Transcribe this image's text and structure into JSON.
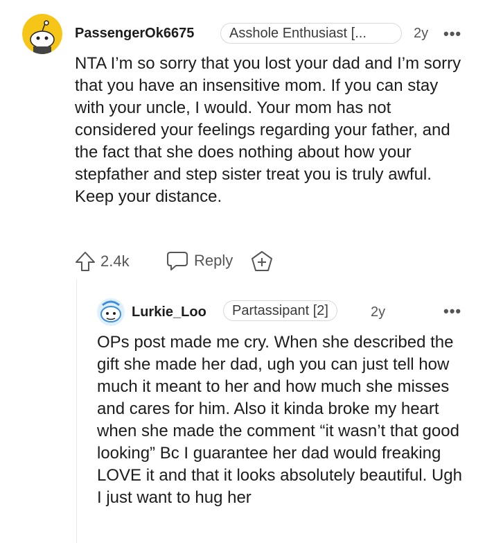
{
  "comment": {
    "username": "PassengerOk6675",
    "flair": "Asshole Enthusiast [...",
    "age": "2y",
    "more": "•••",
    "body": "NTA I’m so sorry that you lost your dad and I’m sorry that you have an insensitive mom. If you can stay with your uncle, I would. Your mom has not considered your feelings regarding your father, and the fact that she does nothing about how your stepfather and step sister treat you is truly awful. Keep your distance.",
    "upvotes": "2.4k",
    "reply_label": "Reply",
    "award_icon": "award-plus-icon",
    "avatar_color": "#f5c518"
  },
  "reply": {
    "username": "Lurkie_Loo",
    "flair": "Partassipant [2]",
    "age": "2y",
    "more": "•••",
    "body": "OPs post made me cry. When she described the gift she made her dad, ugh you can just tell how much it meant to her and how much she misses and cares for him. Also it kinda broke my heart when she made the comment “it wasn’t that good looking” Bc I guarantee her dad would freaking LOVE it and that it looks absolutely beautiful. Ugh I just want to hug her",
    "avatar_color": "#3b8fd9"
  }
}
